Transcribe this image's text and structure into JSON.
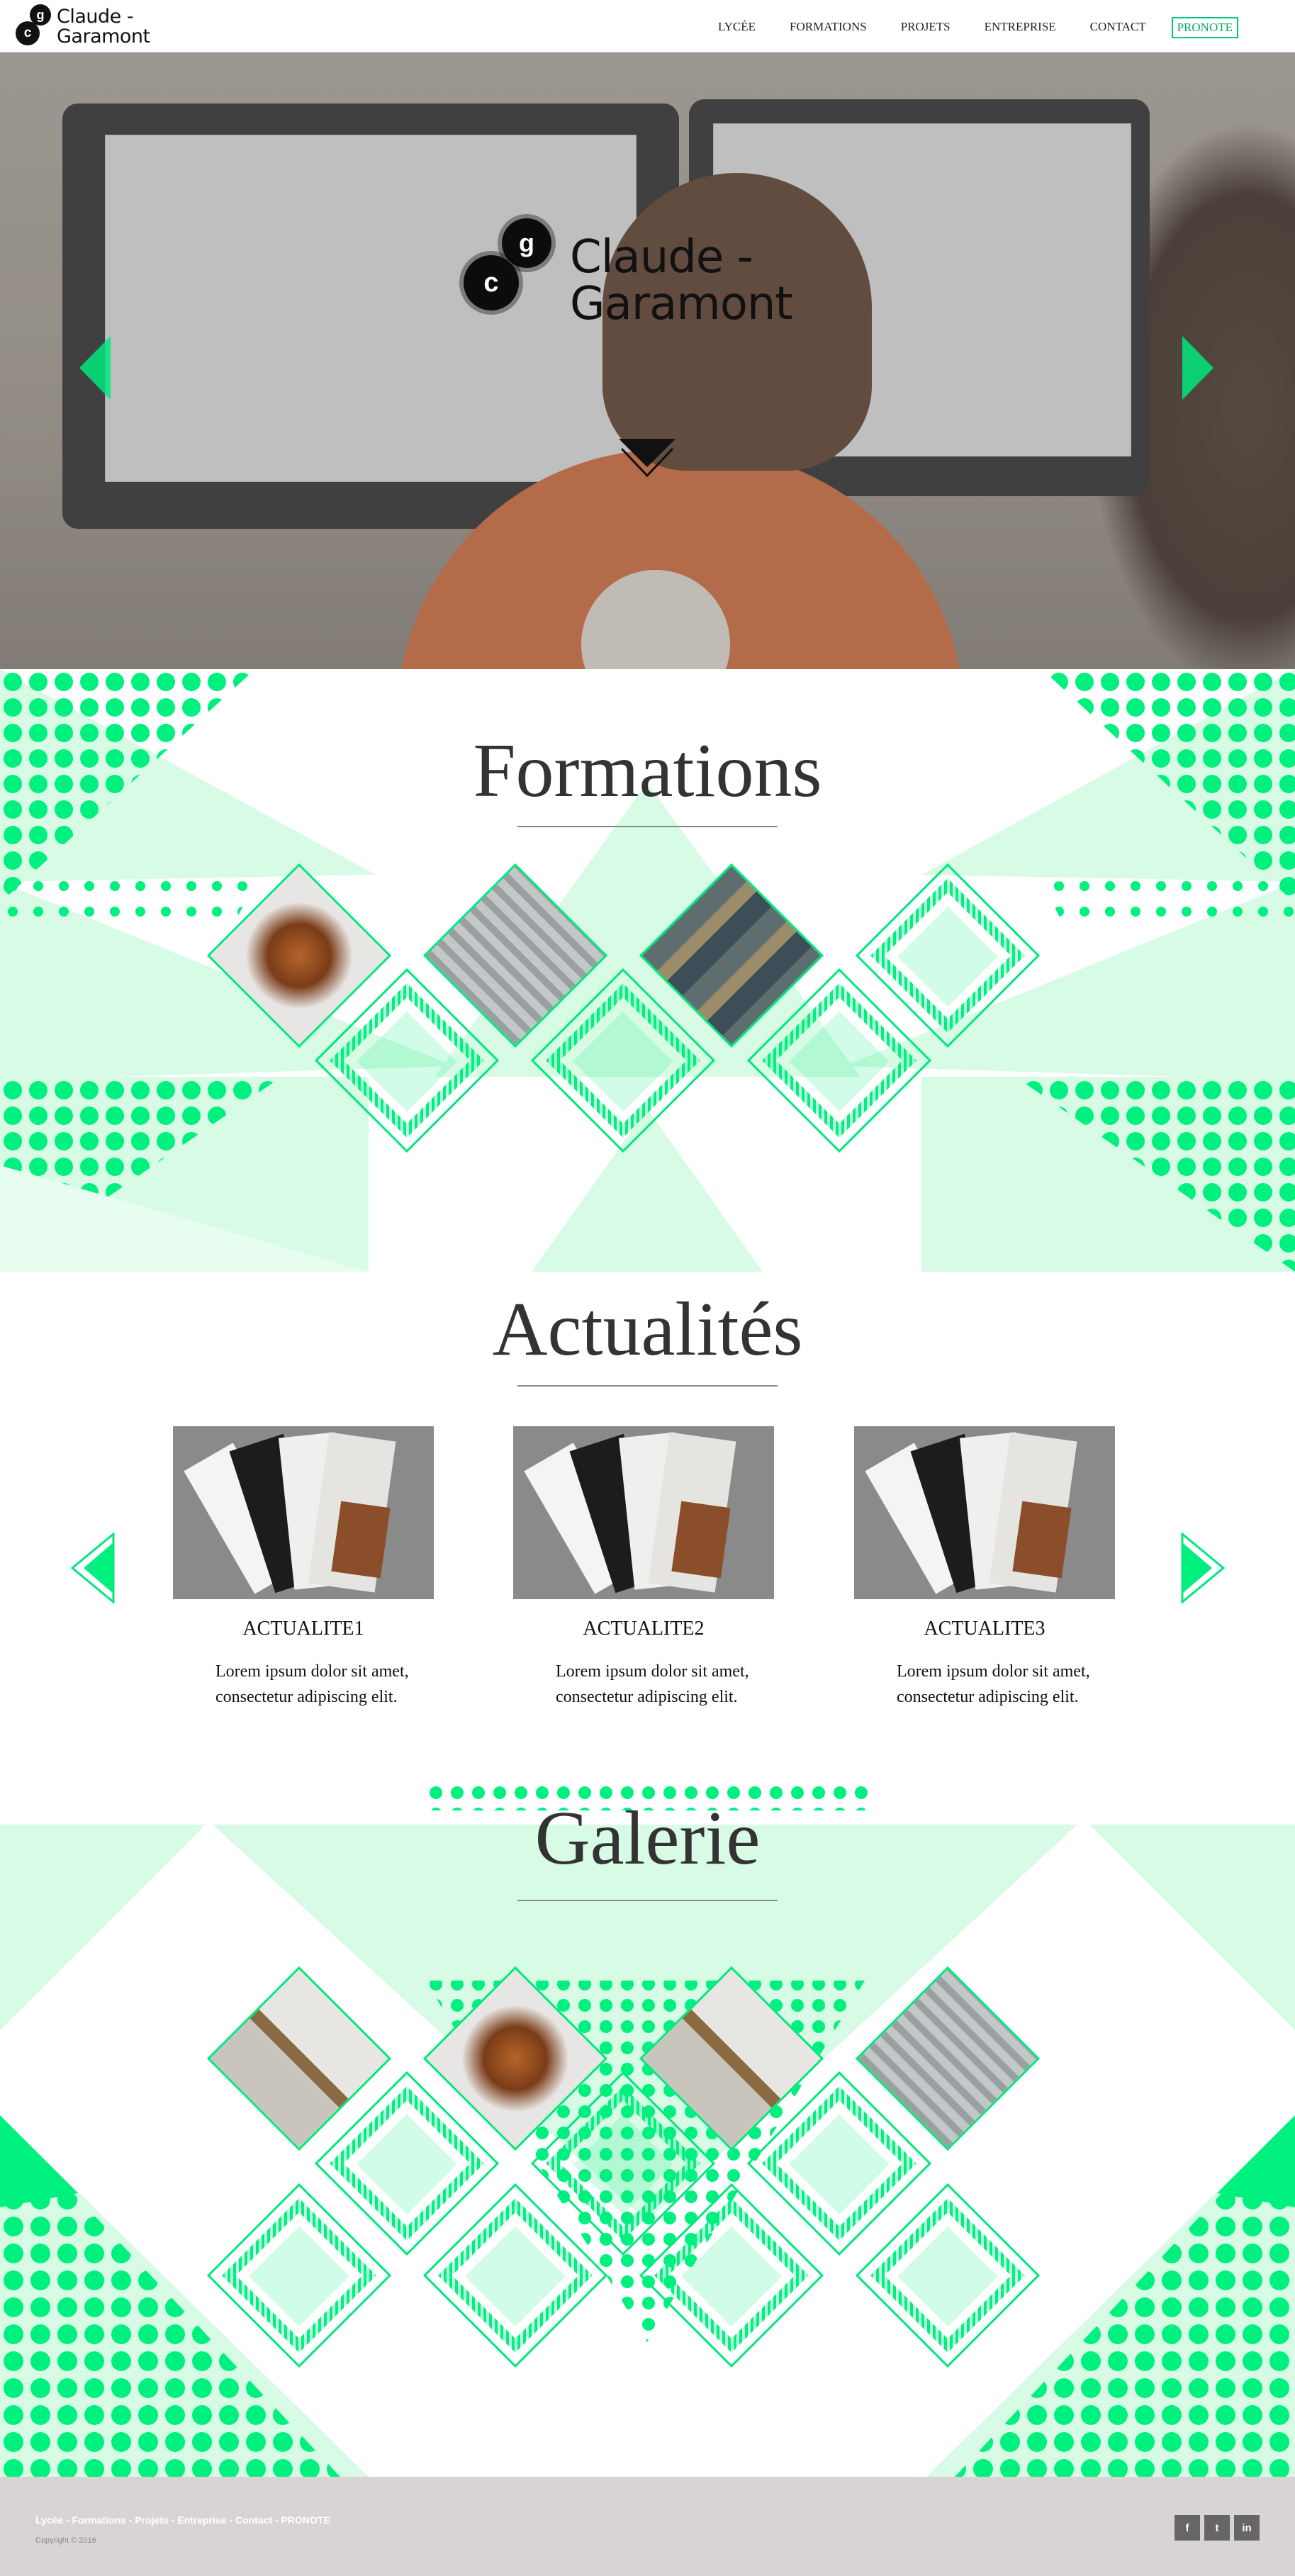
{
  "brand": {
    "name_line1": "Claude -",
    "name_line2": "Garamont",
    "g": "g",
    "c": "c"
  },
  "nav": {
    "items": [
      {
        "label": "LYCÉE"
      },
      {
        "label": "FORMATIONS"
      },
      {
        "label": "PROJETS"
      },
      {
        "label": "ENTREPRISE"
      },
      {
        "label": "CONTACT"
      }
    ],
    "pronote": "PRONOTE"
  },
  "hero": {
    "icons": {
      "prev": "arrow-left-icon",
      "next": "arrow-right-icon",
      "down": "chevron-down-icon"
    }
  },
  "formations": {
    "title": "Formations"
  },
  "actualites": {
    "title": "Actualités",
    "cards": [
      {
        "title": "ACTUALITE1",
        "text": "Lorem ipsum dolor sit amet, consectetur adipiscing elit."
      },
      {
        "title": "ACTUALITE2",
        "text": "Lorem ipsum dolor sit amet, consectetur adipiscing elit."
      },
      {
        "title": "ACTUALITE3",
        "text": "Lorem ipsum dolor sit amet, consectetur adipiscing elit."
      }
    ]
  },
  "galerie": {
    "title": "Galerie"
  },
  "footer": {
    "links": [
      "Lycée",
      "Formations",
      "Projets",
      "Entreprise",
      "Contact",
      "PRONOTE"
    ],
    "separator": " - ",
    "copyright": "Copyright © 2016",
    "social": [
      {
        "label": "f",
        "icon": "facebook-icon"
      },
      {
        "label": "t",
        "icon": "twitter-icon"
      },
      {
        "label": "in",
        "icon": "linkedin-icon"
      }
    ]
  },
  "colors": {
    "accent": "#00f080",
    "accent_light": "#d8fbe6",
    "footer_bg": "#d9d4d3",
    "text": "#333333"
  }
}
